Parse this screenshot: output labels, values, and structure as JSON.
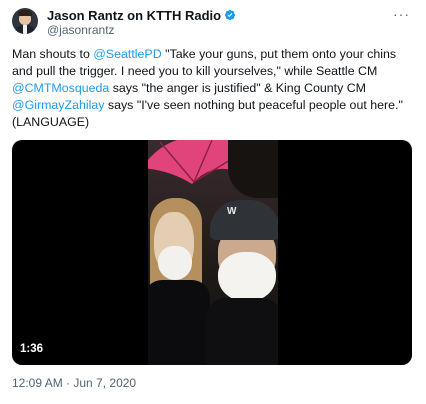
{
  "author": {
    "display_name": "Jason Rantz on KTTH Radio",
    "handle": "@jasonrantz",
    "verified": true,
    "avatar_icon": "profile-photo"
  },
  "more_label": "···",
  "tweet": {
    "lines": [
      [
        {
          "t": "Man shouts to ",
          "m": false
        },
        {
          "t": "@SeattlePD",
          "m": true
        },
        {
          "t": " \"Take your guns, put them onto your chins",
          "m": false
        }
      ],
      [
        {
          "t": "and pull the trigger. I need you to kill yourselves,\" while Seattle CM",
          "m": false
        }
      ],
      [
        {
          "t": "@CMTMosqueda",
          "m": true
        },
        {
          "t": " says \"the anger is justified\" & King County CM",
          "m": false
        }
      ],
      [
        {
          "t": "@GirmayZahilay",
          "m": true
        },
        {
          "t": " says \"I've seen nothing but peaceful people out here.\"",
          "m": false
        }
      ],
      [
        {
          "t": "(LANGUAGE)",
          "m": false
        }
      ]
    ]
  },
  "media": {
    "type": "video",
    "duration": "1:36",
    "cap_logo": "W"
  },
  "timestamp": "12:09 AM · Jun 7, 2020",
  "colors": {
    "link": "#1d9bf0",
    "secondary_text": "#536471",
    "verified_badge": "#1d9bf0",
    "umbrella": "#e0447a"
  }
}
